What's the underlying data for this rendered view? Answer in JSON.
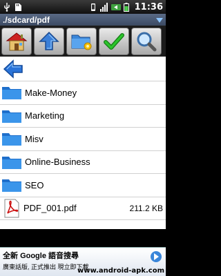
{
  "status_bar": {
    "time": "11:36",
    "icons": [
      "usb-icon",
      "sd-card-icon",
      "vibrate-icon",
      "signal-icon",
      "battery-charging-icon",
      "battery-icon"
    ]
  },
  "path_bar": {
    "path": "./sdcard/pdf",
    "dropdown_icon": "chevron-down-icon"
  },
  "toolbar": {
    "buttons": [
      {
        "icon": "home-icon"
      },
      {
        "icon": "up-arrow-icon"
      },
      {
        "icon": "folder-options-icon"
      },
      {
        "icon": "checkmark-icon"
      },
      {
        "icon": "search-icon"
      }
    ]
  },
  "navigation": {
    "back_icon": "back-arrow-icon"
  },
  "files": [
    {
      "type": "folder",
      "name": "Make-Money"
    },
    {
      "type": "folder",
      "name": "Marketing"
    },
    {
      "type": "folder",
      "name": "Misv"
    },
    {
      "type": "folder",
      "name": "Online-Business"
    },
    {
      "type": "folder",
      "name": "SEO"
    },
    {
      "type": "pdf",
      "name": "PDF_001.pdf",
      "size": "211.2 KB"
    }
  ],
  "ad": {
    "line1_prefix": "全新",
    "line1_brand": "Google",
    "line1_suffix": "語音搜尋",
    "line2": "廣東話版, 正式推出 現立即下載",
    "watermark": "www.android-apk.com"
  },
  "colors": {
    "folder": "#2f8fe0",
    "back_arrow": "#2a73d8",
    "check": "#1aa51a",
    "path_bar": "#4b5a75"
  }
}
